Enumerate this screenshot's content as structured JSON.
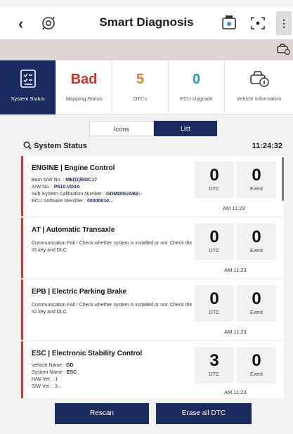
{
  "header": {
    "back_glyph": "‹",
    "title": "Smart Diagnosis",
    "more_glyph": "⋮"
  },
  "tiles": [
    {
      "value": "",
      "caption": "System Status",
      "icon": "checklist-icon",
      "active": true
    },
    {
      "value": "Bad",
      "caption": "Mapping Status",
      "color": "#c0392b"
    },
    {
      "value": "5",
      "caption": "DTCs",
      "color": "#e67e22"
    },
    {
      "value": "0",
      "caption": "ECU Upgrade",
      "color": "#1aa3b8"
    },
    {
      "value": "",
      "caption": "Vehicle Information",
      "icon": "car-info-icon"
    }
  ],
  "view_toggle": {
    "icons": "Icons",
    "list": "List",
    "selected": "List"
  },
  "section": {
    "label": "System Status",
    "time": "11:24:32"
  },
  "systems": [
    {
      "code": "ENGINE",
      "name": "ENGINE | Engine Control",
      "lines": [
        [
          "Boot S/W No. : ",
          "ME(D)/EDC17"
        ],
        [
          "S/W No. : ",
          "P610.VD4A"
        ],
        [
          "Sub System Calibration Number : ",
          "GDMDI5UAB2--"
        ],
        [
          "ECU Software Identifier : ",
          "00000010..."
        ]
      ],
      "dtc": "0",
      "event": "0",
      "dtc_label": "DTC",
      "event_label": "Event",
      "time": "AM 11:23"
    },
    {
      "code": "AT",
      "name": "AT | Automatic Transaxle",
      "message": "Communication Fail / Check whether system is installed or not. Check the IG key and DLC.",
      "dtc": "0",
      "event": "0",
      "dtc_label": "DTC",
      "event_label": "Event",
      "time": "AM 11:23"
    },
    {
      "code": "EPB",
      "name": "EPB | Electric Parking Brake",
      "message": "Communication Fail / Check whether system is installed or not. Check the IG key and DLC.",
      "dtc": "0",
      "event": "0",
      "dtc_label": "DTC",
      "event_label": "Event",
      "time": "AM 11:23"
    },
    {
      "code": "ESC",
      "name": "ESC | Electronic Stability Control",
      "lines": [
        [
          "Vehicle Name : ",
          "GD"
        ],
        [
          "System Name : ",
          "ESC"
        ],
        [
          "H/W Ver. : ",
          "1"
        ],
        [
          "S/W Ver. : ",
          "3..."
        ]
      ],
      "dtc": "3",
      "event": "0",
      "dtc_label": "DTC",
      "event_label": "Event",
      "time": "AM 11:23"
    }
  ],
  "actions": {
    "rescan": "Rescan",
    "erase": "Erase all DTC"
  },
  "colors": {
    "navy": "#1a2b5f",
    "accent_red": "#b6413c"
  }
}
